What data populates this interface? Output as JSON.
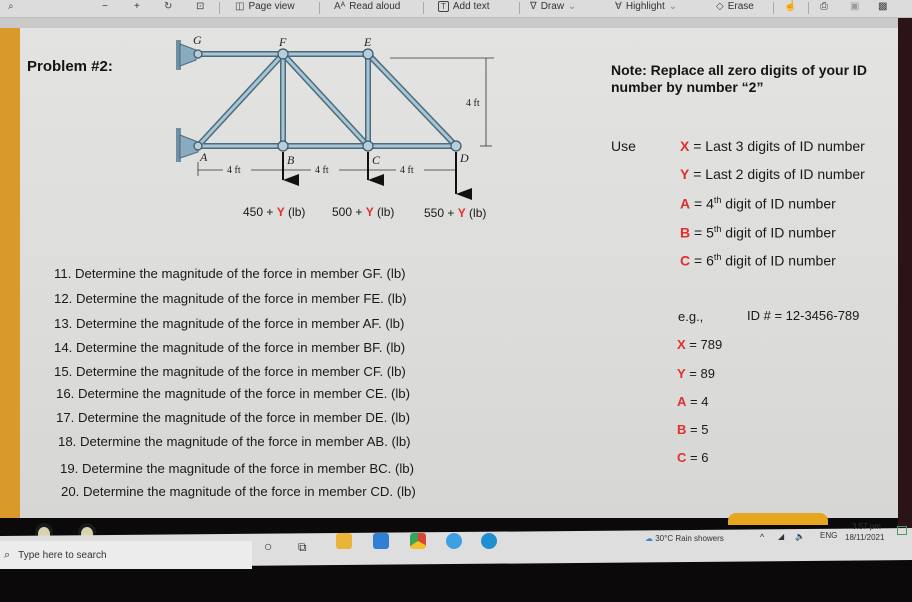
{
  "toolbar": {
    "zoom_out": "−",
    "zoom_in": "+",
    "page_view": "Page view",
    "read_aloud": "Read aloud",
    "add_text": "Add text",
    "draw": "Draw",
    "highlight": "Highlight",
    "erase": "Erase",
    "icons": {
      "search": "⌕",
      "rotate": "↻",
      "fit": "⊡",
      "page_view": "◫",
      "read_aloud": "Aᴬ",
      "add_text": "T",
      "draw": "∇",
      "highlight": "∀",
      "erase": "◇",
      "dropdown": "⌄",
      "touch": "☝",
      "print": "⎙",
      "save": "▣",
      "save_as": "▩"
    }
  },
  "slide": {
    "problem_title": "Problem #2:",
    "truss": {
      "joints": [
        "G",
        "F",
        "E",
        "A",
        "B",
        "C",
        "D"
      ],
      "spans": [
        "4 ft",
        "4 ft",
        "4 ft"
      ],
      "height": "4 ft",
      "loads": [
        {
          "base": "450 + ",
          "var": "Y",
          "unit": " (lb)"
        },
        {
          "base": "500 + ",
          "var": "Y",
          "unit": " (lb)"
        },
        {
          "base": "550 + ",
          "var": "Y",
          "unit": " (lb)"
        }
      ]
    },
    "note": "Note: Replace all zero digits of your ID number by number “2”",
    "use_label": "Use",
    "definitions": [
      {
        "var": "X",
        "text": " = Last 3 digits of ID number",
        "sup": ""
      },
      {
        "var": "Y",
        "text": " = Last 2 digits of ID number",
        "sup": ""
      },
      {
        "var": "A",
        "text_pre": " = 4",
        "sup": "th",
        "text": " digit of ID number"
      },
      {
        "var": "B",
        "text_pre": " = 5",
        "sup": "th",
        "text": " digit of ID number"
      },
      {
        "var": "C",
        "text_pre": " = 6",
        "sup": "th",
        "text": " digit of ID number"
      }
    ],
    "questions": [
      "11. Determine the magnitude of the force in member GF. (lb)",
      "12. Determine the magnitude of the force in member FE. (lb)",
      "13. Determine the magnitude of the force in member AF. (lb)",
      "14. Determine the magnitude of the force in member BF. (lb)",
      "15. Determine the magnitude of the force in member CF. (lb)",
      "16. Determine the magnitude of the force in member CE. (lb)",
      "17. Determine the magnitude of the force in member DE. (lb)",
      "18. Determine the magnitude of the force in member AB. (lb)",
      "19. Determine the magnitude of the force in member BC. (lb)",
      "20. Determine the magnitude of the force in member CD. (lb)"
    ],
    "example": {
      "label": "e.g.,",
      "id": "ID # = 12-3456-789",
      "values": [
        {
          "var": "X",
          "text": " = 789"
        },
        {
          "var": "Y",
          "text": " = 89"
        },
        {
          "var": "A",
          "text": " = 4"
        },
        {
          "var": "B",
          "text": " = 5"
        },
        {
          "var": "C",
          "text": " = 6"
        }
      ]
    }
  },
  "taskbar": {
    "search_placeholder": "Type here to search",
    "search_icon": "⌕",
    "cortana_icon": "○",
    "task_view_icon": "⧉",
    "apps": [
      {
        "name": "file-explorer",
        "color": "#e8b43a"
      },
      {
        "name": "mail",
        "color": "#2f7fd6"
      },
      {
        "name": "chrome",
        "color": "#d94534"
      },
      {
        "name": "skype",
        "color": "#3da0e0"
      },
      {
        "name": "edge",
        "color": "#1f8fcf"
      }
    ],
    "weather": "30°C  Rain showers",
    "tray_chevron": "^",
    "language": "ENG",
    "time": "3:57 pm",
    "date": "18/11/2021"
  }
}
